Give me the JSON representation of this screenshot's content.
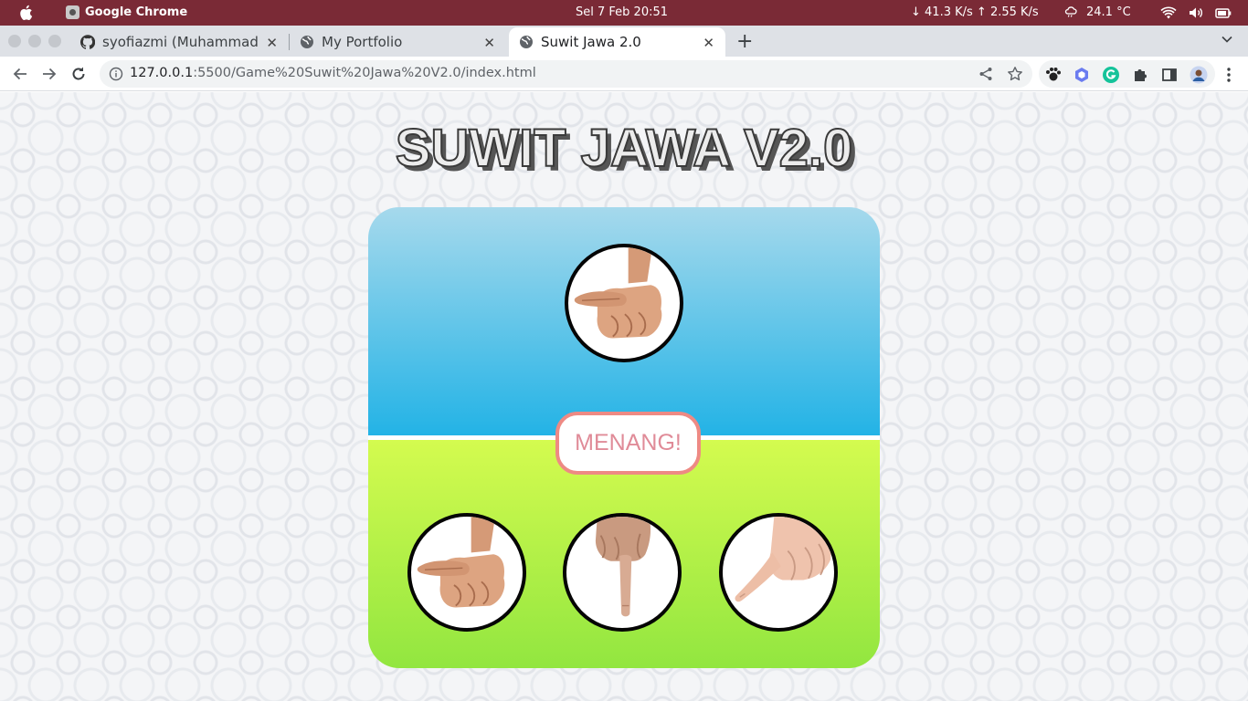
{
  "os_bar": {
    "app_name": "Google Chrome",
    "clock": "Sel  7 Feb  20:51",
    "network": "↓ 41.3 K/s ↑ 2.55 K/s",
    "temperature": "24.1 °C"
  },
  "browser": {
    "tabs": [
      {
        "label": "syofiazmi (Muhammad",
        "icon": "github-icon",
        "active": false
      },
      {
        "label": "My Portfolio",
        "icon": "globe-icon",
        "active": false
      },
      {
        "label": "Suwit Jawa 2.0",
        "icon": "globe-icon",
        "active": true
      }
    ],
    "url_host": "127.0.0.1",
    "url_path": ":5500/Game%20Suwit%20Jawa%20V2.0/index.html"
  },
  "game": {
    "title": "SUWIT JAWA V2.0",
    "computer_choice": "gajah",
    "result": "MENANG!",
    "player_choices": [
      "gajah",
      "orang",
      "semut"
    ],
    "colors": {
      "computer_area_top": "#a6d9ec",
      "computer_area_bottom": "#23b3e6",
      "player_area_top": "#d4fb4f",
      "player_area_bottom": "#92e640",
      "result_border": "#ee8a84",
      "result_text": "#e08b98"
    }
  }
}
